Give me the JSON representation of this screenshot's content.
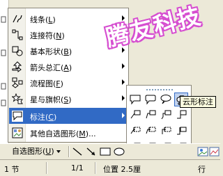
{
  "watermark": "腾友科技",
  "menu": {
    "items": [
      {
        "label": "线条",
        "key": "L",
        "icon": "lines-icon"
      },
      {
        "label": "连接符",
        "key": "N",
        "icon": "connector-icon"
      },
      {
        "label": "基本形状",
        "key": "B",
        "icon": "basic-shapes-icon"
      },
      {
        "label": "箭头总汇",
        "key": "A",
        "icon": "block-arrows-icon"
      },
      {
        "label": "流程图",
        "key": "F",
        "icon": "flowchart-icon"
      },
      {
        "label": "星与旗帜",
        "key": "S",
        "icon": "stars-banners-icon"
      },
      {
        "label": "标注",
        "key": "C",
        "icon": "callouts-icon"
      },
      {
        "label": "其他自选图形",
        "key": "M",
        "suffix": "...",
        "icon": "more-autoshapes-icon"
      }
    ]
  },
  "tooltip": "云形标注",
  "toolbar": {
    "autoshape_label": "自选图形",
    "autoshape_key": "U"
  },
  "status": {
    "section": "1 节",
    "pages": "1/1",
    "position": "位置 2.5厘",
    "row": "行"
  },
  "colors": {
    "highlight": "#316ac5",
    "watermark": "#d64fd0",
    "menu_bg": "#ffffff",
    "chrome": "#ece9d8"
  }
}
